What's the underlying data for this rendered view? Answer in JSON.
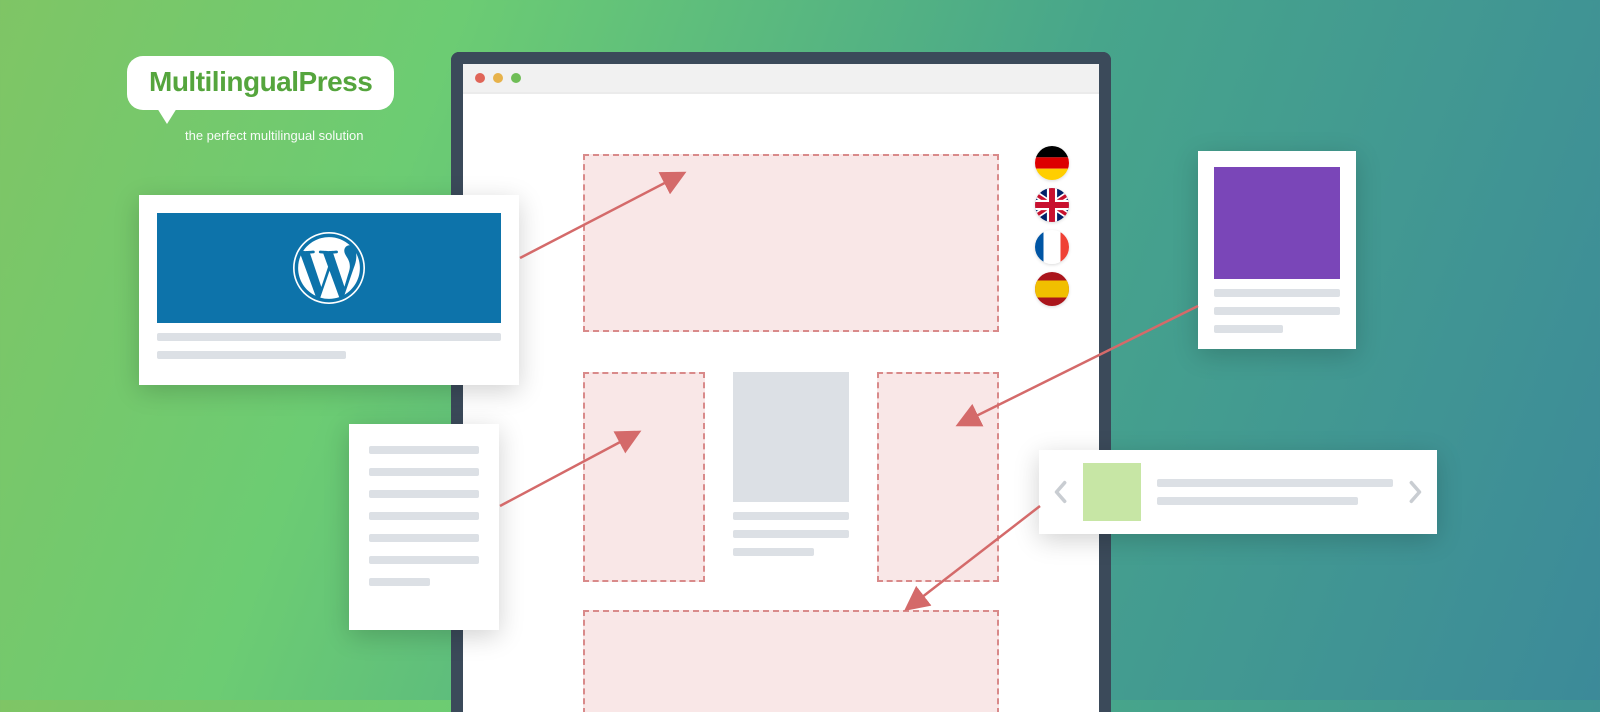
{
  "logo": {
    "brand": "MultilingualPress",
    "tagline": "the perfect multilingual solution"
  },
  "window": {
    "traffic_lights": [
      "close",
      "minimize",
      "maximize"
    ]
  },
  "dropzones": [
    "header",
    "column-left",
    "column-right",
    "footer"
  ],
  "center_card": {
    "lines": 3
  },
  "flags": [
    {
      "name": "germany",
      "svg": "<svg viewBox='0 0 3 3'><rect width='3' height='1' y='0' fill='#000'/><rect width='3' height='1' y='1' fill='#dd0000'/><rect width='3' height='1' y='2' fill='#ffce00'/></svg>"
    },
    {
      "name": "united-kingdom",
      "svg": "<svg viewBox='0 0 60 40'><rect width='60' height='40' fill='#012169'/><path d='M0,0 60,40 M60,0 0,40' stroke='#fff' stroke-width='8'/><path d='M0,0 60,40 M60,0 0,40' stroke='#c8102e' stroke-width='4'/><path d='M30,0 V40 M0,20 H60' stroke='#fff' stroke-width='12'/><path d='M30,0 V40 M0,20 H60' stroke='#c8102e' stroke-width='7'/></svg>"
    },
    {
      "name": "france",
      "svg": "<svg viewBox='0 0 3 2'><rect width='1' height='2' x='0' fill='#0055a4'/><rect width='1' height='2' x='1' fill='#fff'/><rect width='1' height='2' x='2' fill='#ef4135'/></svg>"
    },
    {
      "name": "spain",
      "svg": "<svg viewBox='0 0 3 2'><rect width='3' height='2' fill='#aa151b'/><rect width='3' height='1' y='0.5' fill='#f1bf00'/></svg>"
    }
  ],
  "sources": {
    "wordpress": {
      "name": "wordpress-card"
    },
    "text_doc": {
      "name": "text-document",
      "lines": 7
    },
    "purple": {
      "name": "image-card",
      "lines": 3
    },
    "slider": {
      "name": "carousel-card",
      "lines": 2
    }
  },
  "arrows": [
    {
      "from": "wordpress-card",
      "to": "header-drop"
    },
    {
      "from": "text-document",
      "to": "column-left-drop"
    },
    {
      "from": "image-card",
      "to": "column-right-drop"
    },
    {
      "from": "carousel-card",
      "to": "footer-drop"
    }
  ],
  "colors": {
    "drop_border": "#d98a8a",
    "drop_fill": "#f9e7e7",
    "wp_blue": "#0d73aa",
    "purple": "#7a46b8",
    "slider_green": "#c7e6a5",
    "browser_frame": "#3b4a5a",
    "arrow": "#d46a6a"
  }
}
